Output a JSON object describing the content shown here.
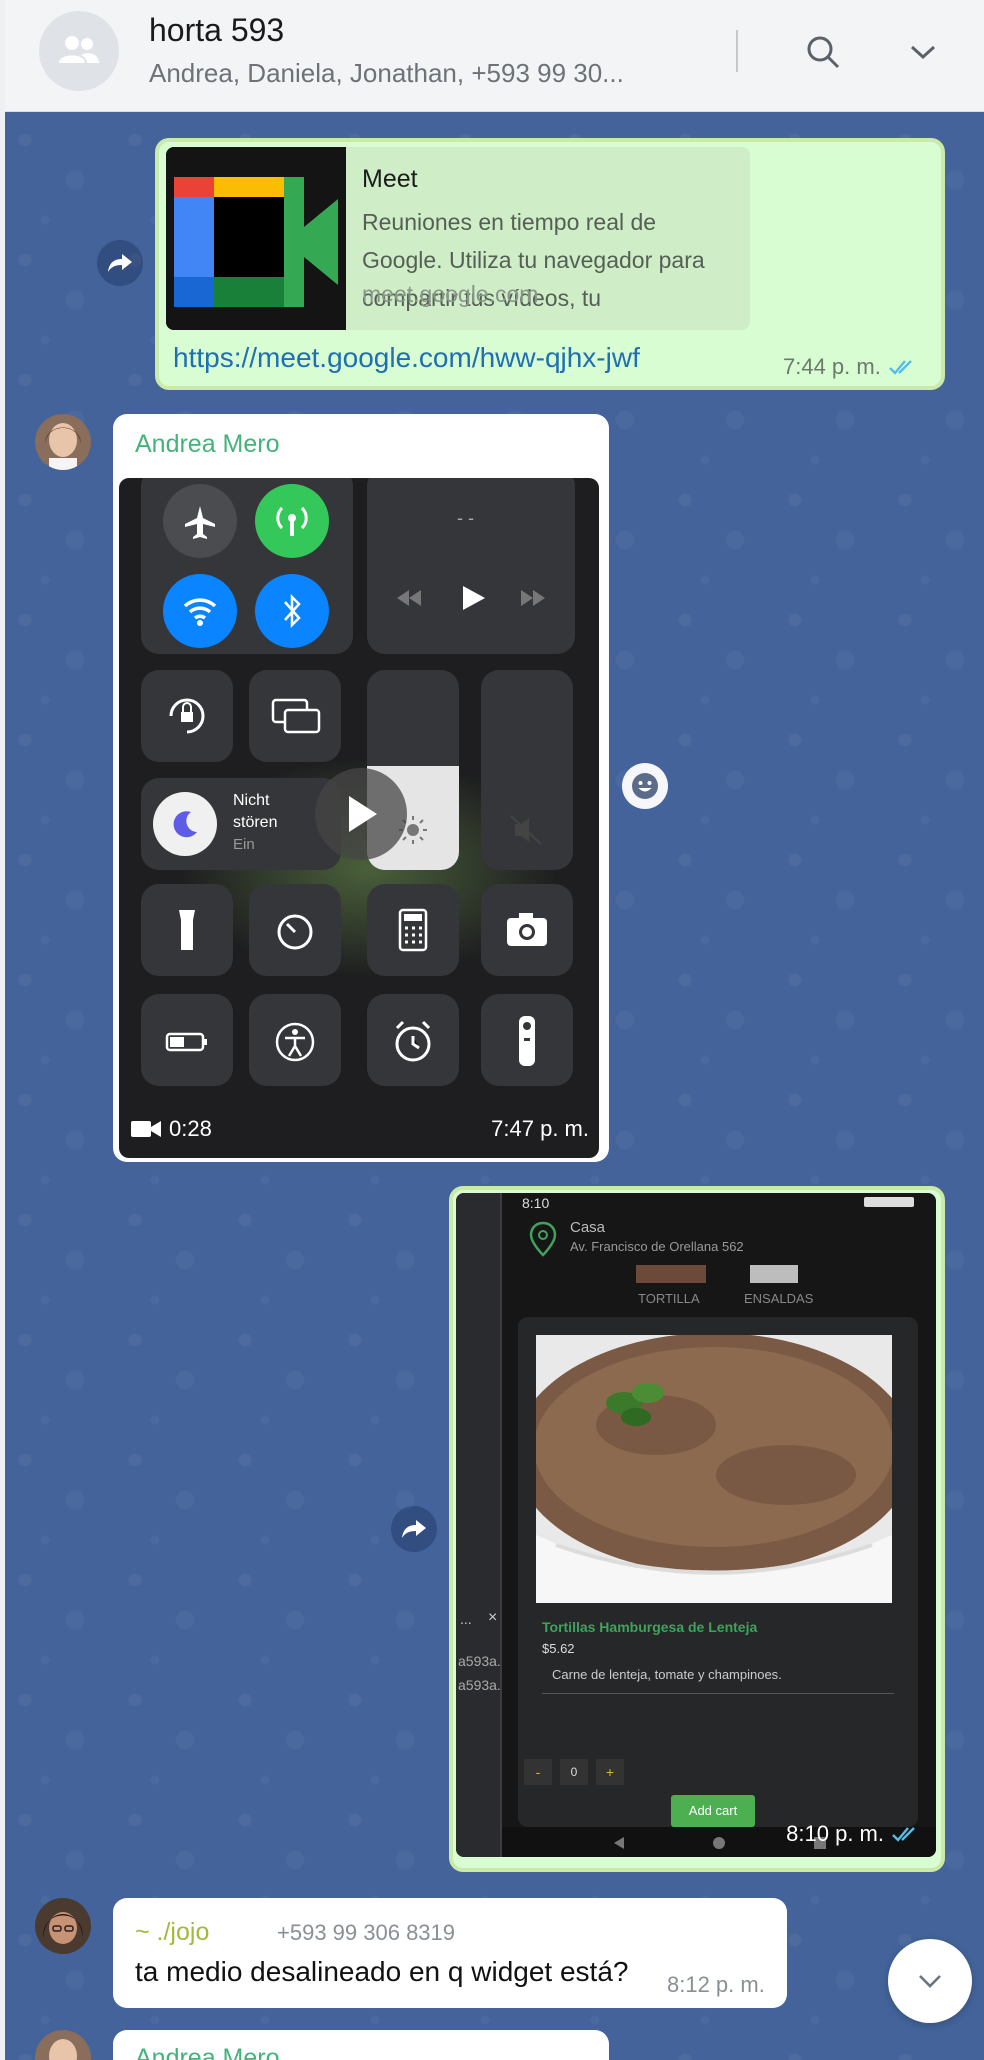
{
  "header": {
    "title": "horta 593",
    "members": "Andrea, Daniela, Jonathan, +593 99 30...",
    "icons": [
      "group-icon",
      "search-icon",
      "chevron-down-icon"
    ]
  },
  "messages": {
    "link": {
      "card_title": "Meet",
      "card_description": "Reuniones en tiempo real de Google. Utiliza tu navegador para compartir tus vídeos, tu",
      "card_domain": "meet.google.com",
      "url": "https://meet.google.com/hww-qjhx-jwf",
      "time": "7:44 p. m."
    },
    "video": {
      "sender": "Andrea Mero",
      "duration": "0:28",
      "time": "7:47 p. m.",
      "screen": {
        "dnd_title": "Nicht",
        "dnd_title2": "stören",
        "dnd_state": "Ein",
        "media_dash": "- -"
      }
    },
    "photo": {
      "time": "8:10 p. m.",
      "screen": {
        "status_time": "8:10",
        "location_title": "Casa",
        "location_address": "Av. Francisco de Orellana 562",
        "tab1": "TORTILLA",
        "tab2": "ENSALDAS",
        "product_name": "Tortillas Hamburgesa de Lenteja",
        "price": "$5.62",
        "description": "Carne de lenteja, tomate y champinoes.",
        "minus": "-",
        "qty": "0",
        "plus": "+",
        "add_cart": "Add cart",
        "side_text1": "a593a.",
        "side_text2": "a593a.",
        "side_menu": "...",
        "side_close": "×"
      }
    },
    "text": {
      "sender": "~ ./jojo",
      "phone": "+593 99 306 8319",
      "body": "ta medio desalineado en q widget está?",
      "time": "8:12 p. m."
    },
    "next_sender": "Andrea Mero"
  },
  "colors": {
    "chat_bg": "#43639a",
    "outgoing_bubble": "#d9fdd3",
    "sender_green": "#43b37a",
    "link_blue": "#1f6fb2",
    "read_ticks": "#53bdeb"
  }
}
